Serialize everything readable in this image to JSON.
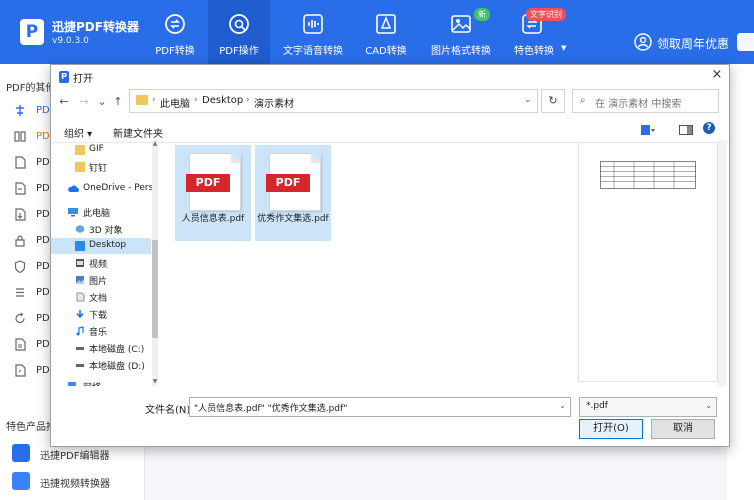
{
  "app": {
    "name": "迅捷PDF转换器",
    "version": "v9.0.3.0",
    "logo_letter": "P",
    "accent": "#2a6de8"
  },
  "nav": [
    {
      "label": "PDF转换",
      "icon": "pdf-convert-icon"
    },
    {
      "label": "PDF操作",
      "icon": "pdf-operate-icon",
      "active": true
    },
    {
      "label": "文字语音转换",
      "icon": "voice-wave-icon"
    },
    {
      "label": "CAD转换",
      "icon": "cad-icon"
    },
    {
      "label": "图片格式转换",
      "icon": "image-icon",
      "badge": "新"
    },
    {
      "label": "特色转换",
      "icon": "special-convert-icon",
      "badge": "文字识别",
      "dropdown": "▼"
    }
  ],
  "promo": {
    "label": "领取周年优惠"
  },
  "sidebar": {
    "header": "PDF的其他",
    "rows": [
      "PD",
      "PD",
      "PD",
      "PD",
      "PD",
      "PD",
      "PD",
      "PD",
      "PD",
      "PD",
      "PD"
    ],
    "products_title": "特色产品推",
    "products": [
      "迅捷PDF编辑器",
      "迅捷视频转换器"
    ]
  },
  "dialog": {
    "title": "打开",
    "close": "×",
    "nav_back": "←",
    "nav_forward": "→",
    "nav_recent": "⌄",
    "nav_up": "↑",
    "breadcrumbs": [
      "此电脑",
      "Desktop",
      "演示素材"
    ],
    "address_dropdown": "⌄",
    "refresh": "↻",
    "search_placeholder": "在 演示素材 中搜索",
    "search_icon": "⌕",
    "toolbar": {
      "organize": "组织 ▾",
      "new_folder": "新建文件夹",
      "help": "?"
    },
    "tree": [
      {
        "label": "GIF",
        "icon": "folder-icon",
        "indent": 1
      },
      {
        "label": "钉钉",
        "icon": "folder-icon",
        "indent": 1
      },
      {
        "label": "OneDrive - Pers",
        "icon": "cloud-icon",
        "indent": 0
      },
      {
        "label": "此电脑",
        "icon": "computer-icon",
        "indent": 0
      },
      {
        "label": "3D 对象",
        "icon": "cube-icon",
        "indent": 1
      },
      {
        "label": "Desktop",
        "icon": "desktop-icon",
        "indent": 1,
        "selected": true
      },
      {
        "label": "视频",
        "icon": "video-icon",
        "indent": 1
      },
      {
        "label": "图片",
        "icon": "picture-icon",
        "indent": 1
      },
      {
        "label": "文档",
        "icon": "document-icon",
        "indent": 1
      },
      {
        "label": "下载",
        "icon": "download-icon",
        "indent": 1
      },
      {
        "label": "音乐",
        "icon": "music-icon",
        "indent": 1
      },
      {
        "label": "本地磁盘 (C:)",
        "icon": "drive-icon",
        "indent": 1
      },
      {
        "label": "本地磁盘 (D:)",
        "icon": "drive-icon",
        "indent": 1
      },
      {
        "label": "网络",
        "icon": "network-icon",
        "indent": 0
      }
    ],
    "files": [
      {
        "name": "人员信息表.pdf",
        "tag": "PDF"
      },
      {
        "name": "优秀作文集选.pdf",
        "tag": "PDF"
      }
    ],
    "filename_label": "文件名(N):",
    "filename_value": "\"人员信息表.pdf\" \"优秀作文集选.pdf\"",
    "filetype": "*.pdf",
    "open_button": "打开(O)",
    "cancel_button": "取消"
  }
}
